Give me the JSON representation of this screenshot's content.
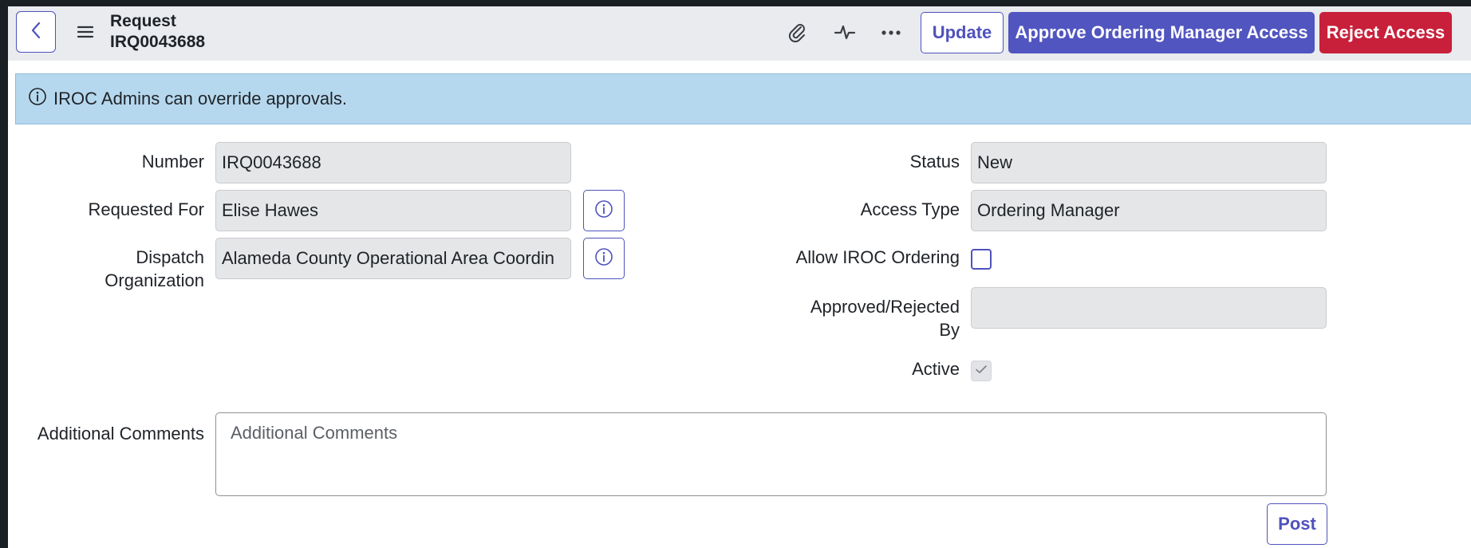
{
  "header": {
    "title_line1": "Request",
    "title_line2": "IRQ0043688",
    "update_label": "Update",
    "approve_label": "Approve Ordering Manager Access",
    "reject_label": "Reject Access"
  },
  "banner": {
    "text": "IROC Admins can override approvals."
  },
  "form": {
    "number_label": "Number",
    "number_value": "IRQ0043688",
    "requested_for_label": "Requested For",
    "requested_for_value": "Elise Hawes",
    "dispatch_label_line1": "Dispatch",
    "dispatch_label_line2": "Organization",
    "dispatch_value": "Alameda County Operational Area Coordin",
    "status_label": "Status",
    "status_value": "New",
    "access_type_label": "Access Type",
    "access_type_value": "Ordering Manager",
    "allow_ordering_label": "Allow IROC Ordering",
    "approved_by_label_line1": "Approved/Rejected",
    "approved_by_label_line2": "By",
    "approved_by_value": "",
    "active_label": "Active",
    "comments_label": "Additional Comments",
    "comments_placeholder": "Additional Comments",
    "post_label": "Post"
  },
  "colors": {
    "accent": "#4f52bd",
    "primary_button": "#5155bf",
    "danger_button": "#c8203a",
    "banner_bg": "#b6d8ee",
    "readonly_field_bg": "#e5e6e8"
  },
  "icons": {
    "back": "chevron-left-icon",
    "menu": "hamburger-menu-icon",
    "attachment": "paperclip-icon",
    "activity": "activity-pulse-icon",
    "more": "more-dots-icon",
    "info": "info-circle-icon",
    "check": "checkmark-icon"
  }
}
